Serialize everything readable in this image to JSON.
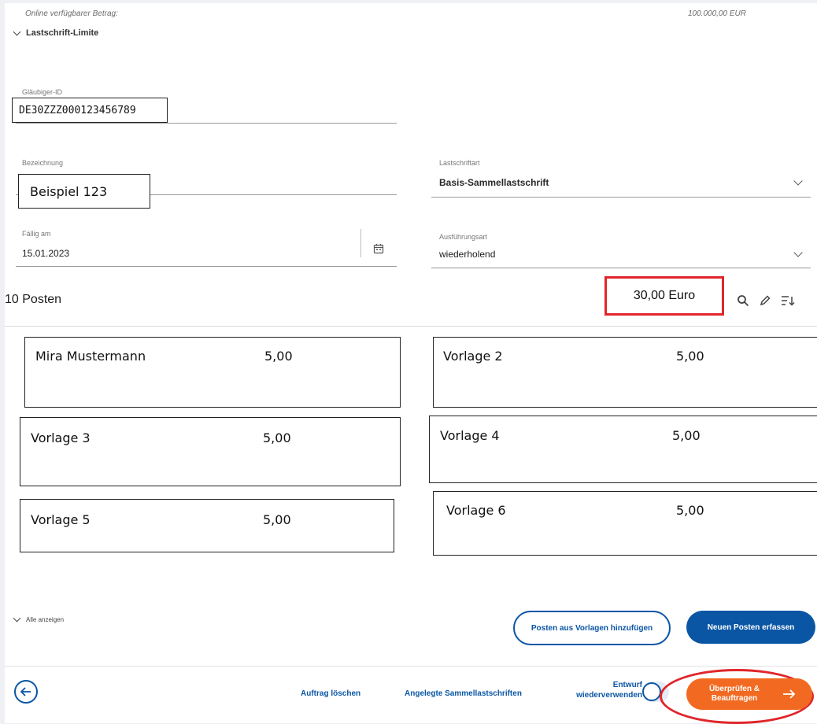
{
  "header": {
    "available_label": "Online verfügbarer Betrag:",
    "available_value": "100.000,00 EUR",
    "section_toggle": "Lastschrift-Limite"
  },
  "form": {
    "creditor_id": {
      "label": "Gläubiger-ID",
      "value": "DE30ZZZ000123456789"
    },
    "description": {
      "label": "Bezeichnung",
      "value": "Beispiel  123"
    },
    "debit_type": {
      "label": "Lastschriftart",
      "value": "Basis-Sammellastschrift"
    },
    "due_date": {
      "label": "Fällig am",
      "value": "15.01.2023"
    },
    "execution_type": {
      "label": "Ausführungsart",
      "value": "wiederholend"
    }
  },
  "items_header": {
    "count_label": "10 Posten",
    "total": "30,00 Euro"
  },
  "items": [
    {
      "name": "Mira Mustermann",
      "amount": "5,00"
    },
    {
      "name": "Vorlage 2",
      "amount": "5,00"
    },
    {
      "name": "Vorlage 3",
      "amount": "5,00"
    },
    {
      "name": "Vorlage 4",
      "amount": "5,00"
    },
    {
      "name": "Vorlage 5",
      "amount": "5,00"
    },
    {
      "name": "Vorlage 6",
      "amount": "5,00"
    }
  ],
  "list_actions": {
    "show_all": "Alle anzeigen",
    "add_from_templates": "Posten aus Vorlagen hinzufügen",
    "new_item": "Neuen Posten erfassen"
  },
  "footer": {
    "delete_order": "Auftrag löschen",
    "created_collections": "Angelegte Sammellastschriften",
    "reuse_draft_line1": "Entwurf",
    "reuse_draft_line2": "wiederverwenden",
    "submit_line1": "Überprüfen &",
    "submit_line2": "Beauftragen"
  },
  "colors": {
    "accent_blue": "#0a56a5",
    "submit_orange": "#f26a21",
    "highlight_red": "#e0262b"
  }
}
